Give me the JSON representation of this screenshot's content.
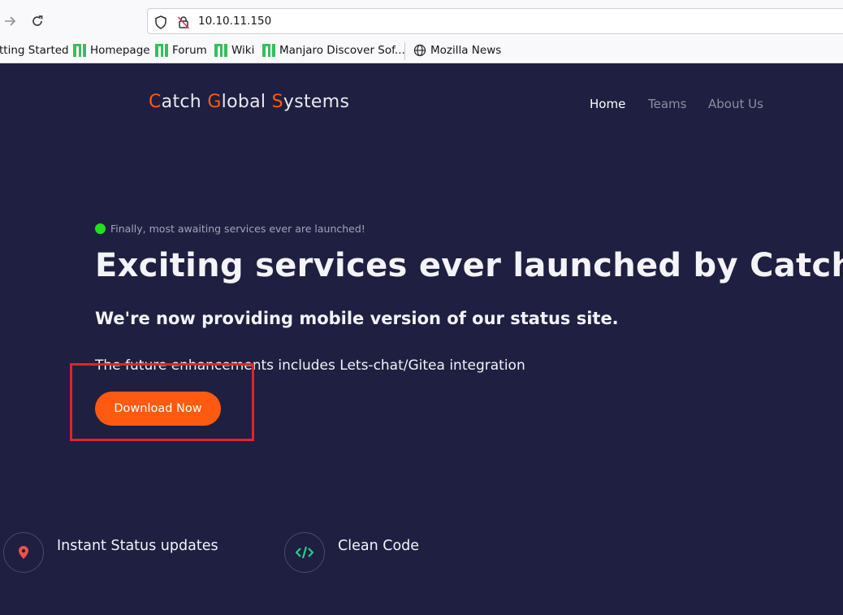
{
  "browser": {
    "url": "10.10.11.150",
    "bookmarks": [
      {
        "label": "tting Started"
      },
      {
        "label": "Homepage"
      },
      {
        "label": "Forum"
      },
      {
        "label": "Wiki"
      },
      {
        "label": "Manjaro Discover Sof..."
      },
      {
        "label": "Mozilla News"
      }
    ]
  },
  "site": {
    "brand": {
      "c": "C",
      "atch": "atch ",
      "g": "G",
      "lobal": "lobal ",
      "s": "S",
      "ystems": "ystems"
    },
    "nav": {
      "home": "Home",
      "teams": "Teams",
      "about": "About Us"
    },
    "status_line": "Finally, most awaiting services ever are launched!",
    "hero_title": "Exciting services ever launched by Catch!",
    "hero_subtitle": "We're now providing mobile version of our status site.",
    "hero_note": "The future enhancements includes Lets-chat/Gitea integration",
    "download_label": "Download Now",
    "features": [
      {
        "title": "Instant Status updates",
        "icon": "location-pin-icon"
      },
      {
        "title": "Clean Code",
        "icon": "code-icon"
      }
    ]
  },
  "colors": {
    "background": "#1f1f41",
    "accent": "#ff5a10",
    "status_dot": "#21e021",
    "highlight": "#e0242d"
  }
}
